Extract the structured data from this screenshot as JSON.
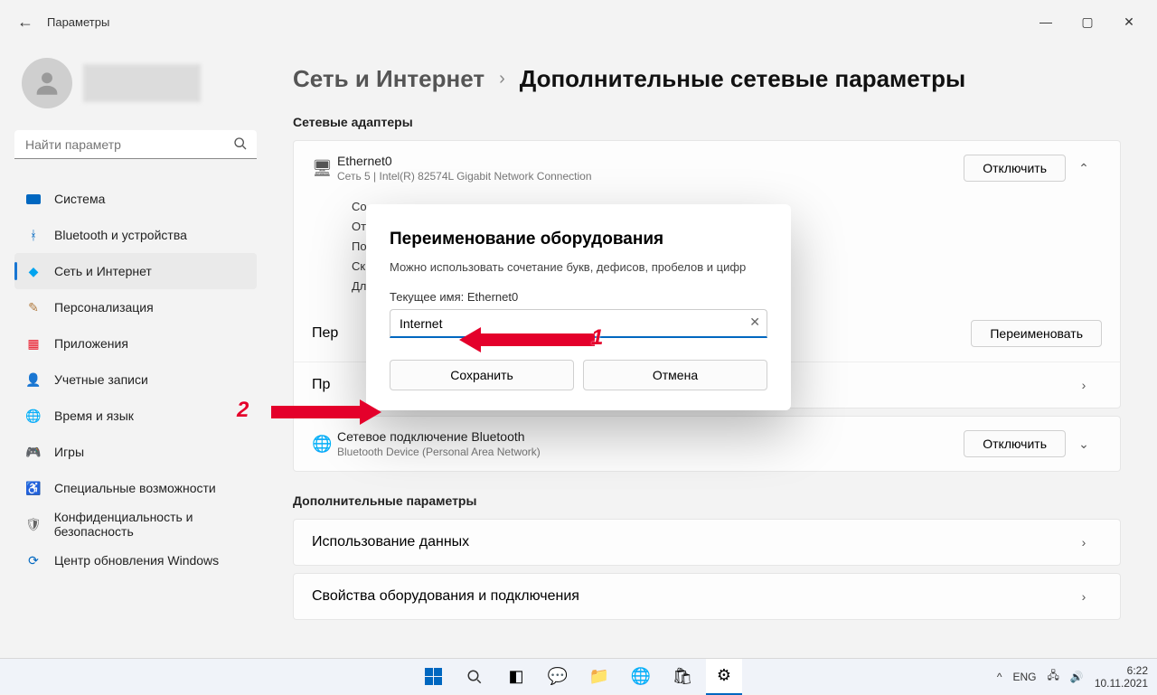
{
  "app_title": "Параметры",
  "search_placeholder": "Найти параметр",
  "nav": [
    {
      "label": "Система"
    },
    {
      "label": "Bluetooth и устройства"
    },
    {
      "label": "Сеть и Интернет"
    },
    {
      "label": "Персонализация"
    },
    {
      "label": "Приложения"
    },
    {
      "label": "Учетные записи"
    },
    {
      "label": "Время и язык"
    },
    {
      "label": "Игры"
    },
    {
      "label": "Специальные возможности"
    },
    {
      "label": "Конфиденциальность и безопасность"
    },
    {
      "label": "Центр обновления Windows"
    }
  ],
  "crumb": {
    "parent": "Сеть и Интернет",
    "current": "Дополнительные сетевые параметры"
  },
  "sections": {
    "adapters": "Сетевые адаптеры",
    "more": "Дополнительные параметры"
  },
  "adapter1": {
    "name": "Ethernet0",
    "sub": "Сеть 5 | Intel(R) 82574L Gigabit Network Connection",
    "disable": "Отключить",
    "props": [
      "Со",
      "От",
      "По",
      "Ск",
      "Дл"
    ],
    "rename_action": "Пер",
    "rename_btn": "Переименовать"
  },
  "adapter2": {
    "name": "Сетевое подключение Bluetooth",
    "sub": "Bluetooth Device (Personal Area Network)",
    "disable": "Отключить"
  },
  "card_usage": "Использование данных",
  "card_hwprops": "Свойства оборудования и подключения",
  "modal": {
    "title": "Переименование оборудования",
    "hint": "Можно использовать сочетание букв, дефисов, пробелов и цифр",
    "current_label": "Текущее имя: Ethernet0",
    "value": "Internet",
    "save": "Сохранить",
    "cancel": "Отмена"
  },
  "annotations": {
    "one": "1",
    "two": "2"
  },
  "tray": {
    "lang": "ENG",
    "time": "6:22",
    "date": "10.11.2021"
  }
}
